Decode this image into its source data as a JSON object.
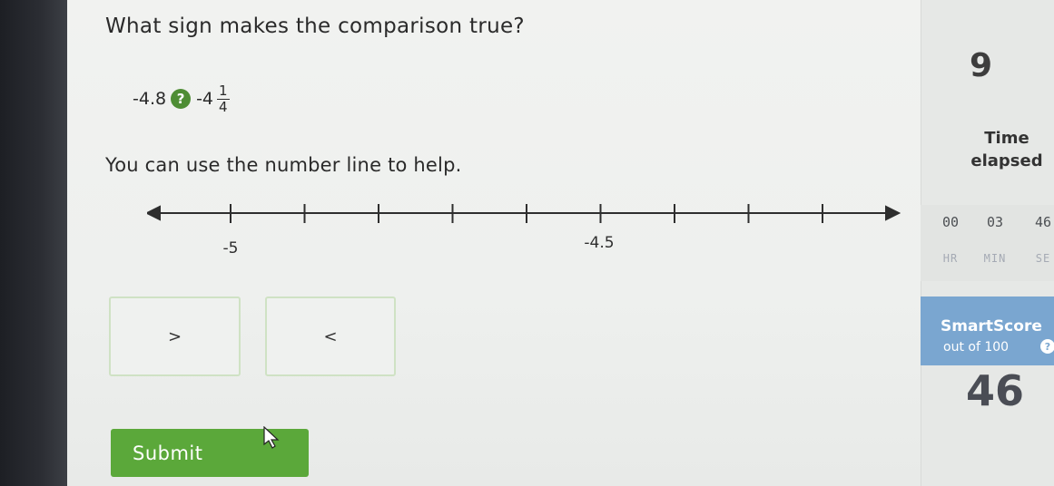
{
  "question": {
    "prompt": "What sign makes the comparison true?",
    "left_value": "-4.8",
    "unknown_symbol": "?",
    "right_whole": "-4",
    "right_numerator": "1",
    "right_denominator": "4",
    "hint": "You can use the number line to help."
  },
  "number_line": {
    "label_left": "-5",
    "label_mid": "-4.5",
    "ticks": 9
  },
  "choices": [
    {
      "label": ">"
    },
    {
      "label": "<"
    }
  ],
  "submit_label": "Submit",
  "sidebar": {
    "question_number": "9",
    "time_label_line1": "Time",
    "time_label_line2": "elapsed",
    "timer": {
      "hours": "00",
      "minutes": "03",
      "seconds": "46",
      "hours_unit": "HR",
      "minutes_unit": "MIN",
      "seconds_unit": "SE"
    },
    "smartscore_title": "SmartScore",
    "smartscore_sub": "out of 100",
    "smartscore_value": "46"
  },
  "colors": {
    "submit_green": "#5ba83a",
    "smartscore_blue": "#7aa6d0",
    "qmark_green": "#4e8d34"
  }
}
